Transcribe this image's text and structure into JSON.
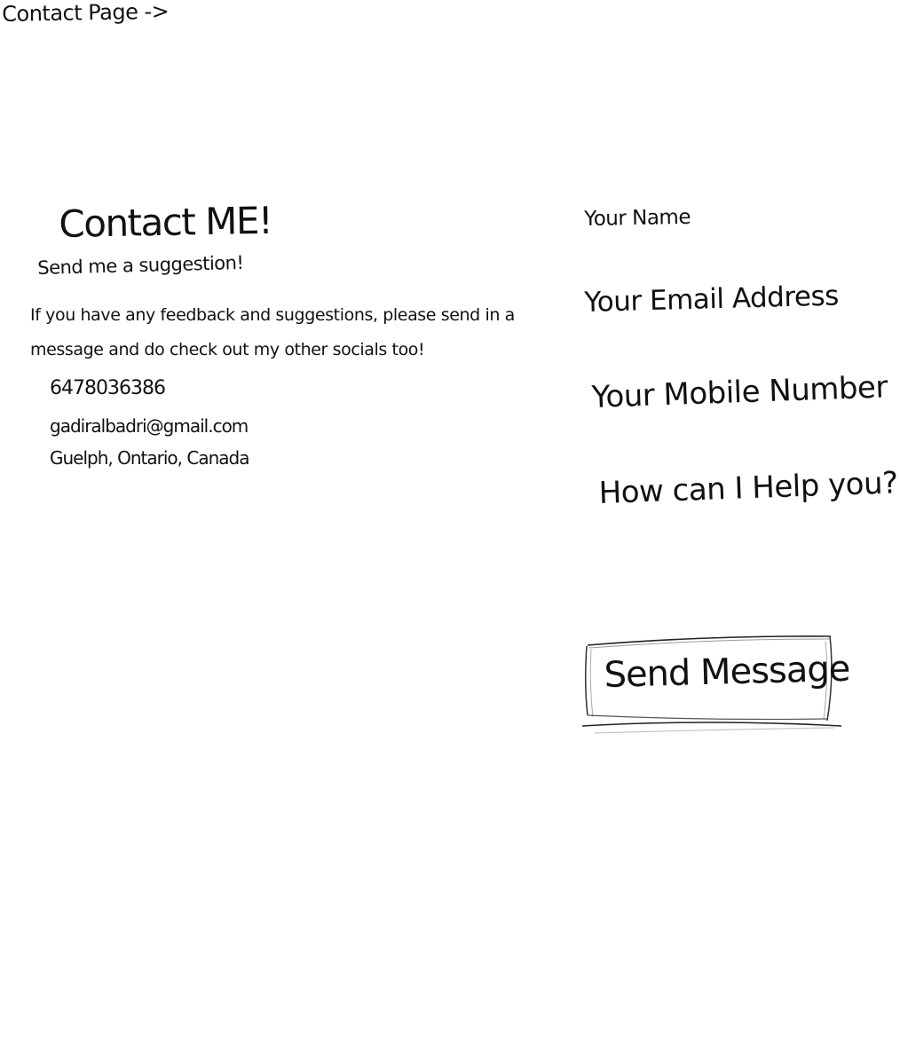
{
  "page_label": "Contact Page ->",
  "contact": {
    "title": "Contact ME!",
    "subtitle": "Send me a suggestion!",
    "intro": "If you have any feedback and suggestions, please send in a message and do check out my other socials too!",
    "phone": "6478036386",
    "email": "gadiralbadri@gmail.com",
    "location": "Guelph, Ontario, Canada"
  },
  "form": {
    "name_label": "Your Name",
    "email_label": "Your Email Address",
    "phone_label": "Your Mobile Number",
    "message_label": "How can I Help you?",
    "send_label": "Send Message"
  }
}
